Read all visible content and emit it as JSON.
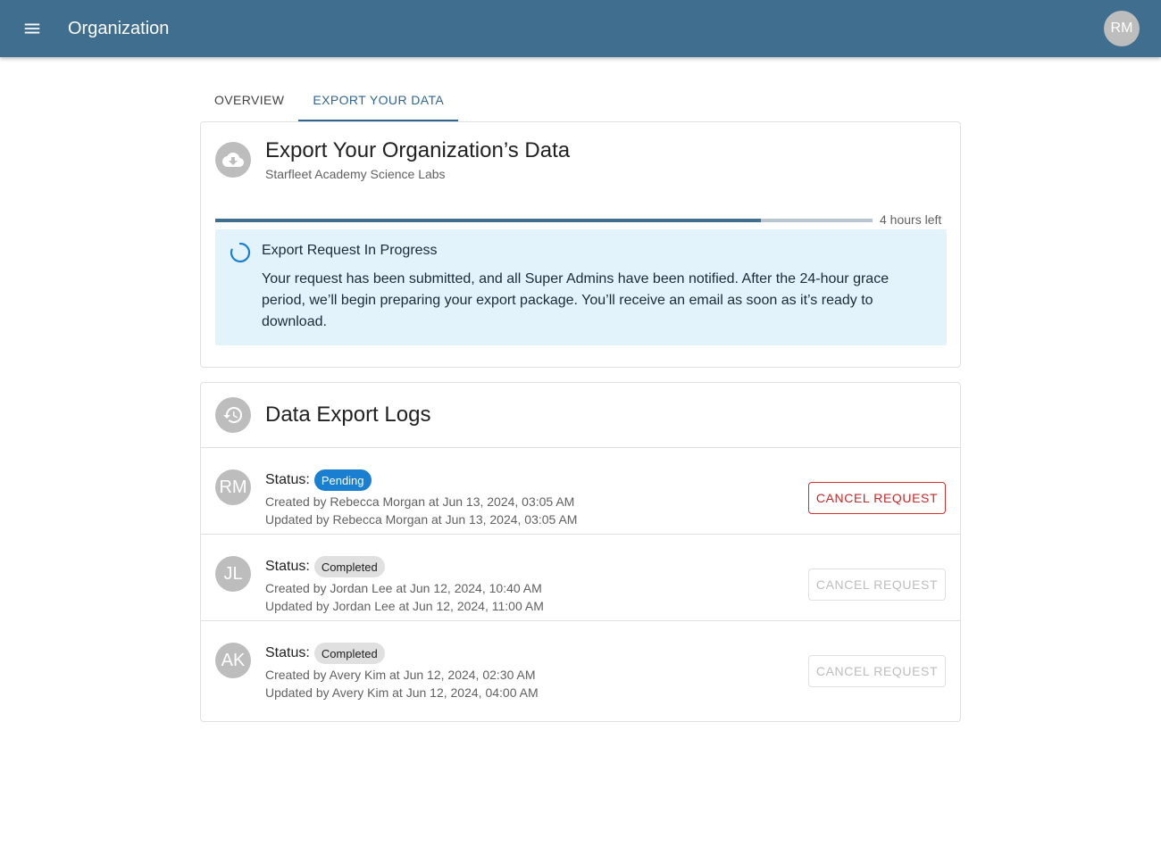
{
  "appbar": {
    "title": "Organization",
    "menu_icon": "menu-icon",
    "user_initials": "RM",
    "color": "#3f6e8f"
  },
  "tabs": [
    {
      "label": "OVERVIEW",
      "active": false
    },
    {
      "label": "EXPORT YOUR DATA",
      "active": true
    }
  ],
  "export_card": {
    "icon": "cloud-download-icon",
    "title": "Export Your Organization’s Data",
    "subtitle": "Starfleet Academy Science Labs",
    "progress_fraction": 0.83,
    "progress_label": "4 hours left",
    "alert": {
      "icon": "spinner-icon",
      "title": "Export Request In Progress",
      "body": "Your request has been submitted, and all Super Admins have been notified. After the 24-hour grace period, we’ll begin preparing your export package. You’ll receive an email as soon as it’s ready to download."
    }
  },
  "logs_card": {
    "icon": "history-icon",
    "title": "Data Export Logs",
    "status_label": "Status:",
    "cancel_label": "CANCEL REQUEST",
    "rows": [
      {
        "initials": "RM",
        "status": "Pending",
        "created": "Created by Rebecca Morgan at Jun 13, 2024, 03:05 AM",
        "updated": "Updated by Rebecca Morgan at Jun 13, 2024, 03:05 AM",
        "cancel_enabled": true
      },
      {
        "initials": "JL",
        "status": "Completed",
        "created": "Created by Jordan Lee at Jun 12, 2024, 10:40 AM",
        "updated": "Updated by Jordan Lee at Jun 12, 2024, 11:00 AM",
        "cancel_enabled": false
      },
      {
        "initials": "AK",
        "status": "Completed",
        "created": "Created by Avery Kim at Jun 12, 2024, 02:30 AM",
        "updated": "Updated by Avery Kim at Jun 12, 2024, 04:00 AM",
        "cancel_enabled": false
      }
    ]
  }
}
